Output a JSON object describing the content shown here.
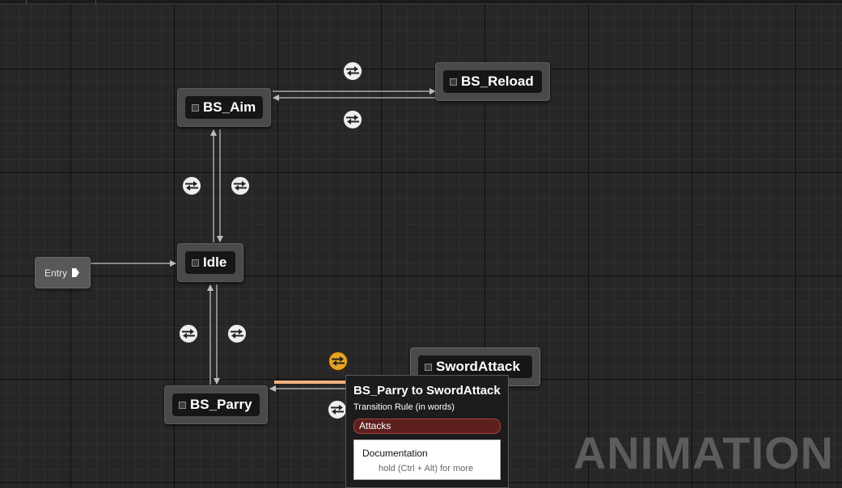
{
  "graph": {
    "entry_label": "Entry",
    "states": {
      "bs_aim": "BS_Aim",
      "bs_reload": "BS_Reload",
      "idle": "Idle",
      "bs_parry": "BS_Parry",
      "sword_attack": "SwordAttack"
    },
    "transition_icon": "transition-swap-icon",
    "highlighted_color": "#e8a323"
  },
  "tooltip": {
    "title": "BS_Parry to SwordAttack",
    "subtitle": "Transition Rule (in words)",
    "rule": "Attacks",
    "doc_title": "Documentation",
    "doc_hint": "hold (Ctrl + Alt) for more"
  },
  "watermark": "ANIMATION",
  "colors": {
    "background": "#262626",
    "rule_fill": "#5e1f1f",
    "highlight_wire": "#f0b07c"
  }
}
